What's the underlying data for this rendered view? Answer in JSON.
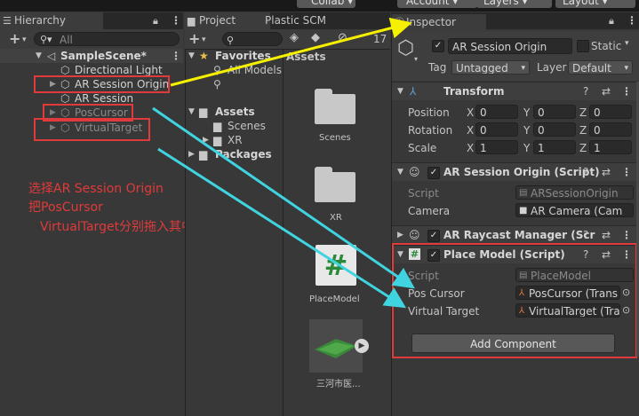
{
  "top_bar": {
    "collab": "Collab",
    "account": "Account",
    "layers": "Layers",
    "layout": "Layout"
  },
  "hierarchy": {
    "tab": "Hierarchy",
    "search_placeholder": "All",
    "scene": "SampleScene*",
    "items": [
      {
        "label": "Directional Light"
      },
      {
        "label": "AR Session Origin"
      },
      {
        "label": "AR Session"
      },
      {
        "label": "PosCursor"
      },
      {
        "label": "VirtualTarget"
      }
    ]
  },
  "project": {
    "tab_project": "Project",
    "tab_plastic": "Plastic SCM",
    "count": "17",
    "tree": {
      "favorites": "Favorites",
      "all_models": "All Models",
      "assets": "Assets",
      "scenes": "Scenes",
      "xr": "XR",
      "packages": "Packages"
    },
    "assets_header": "Assets",
    "grid": [
      {
        "label": "Scenes"
      },
      {
        "label": "XR"
      },
      {
        "label": "PlaceModel"
      },
      {
        "label": "三河市医..."
      }
    ]
  },
  "inspector": {
    "tab": "Inspector",
    "object_name": "AR Session Origin",
    "static_label": "Static",
    "tag_label": "Tag",
    "tag_value": "Untagged",
    "layer_label": "Layer",
    "layer_value": "Default",
    "transform": {
      "title": "Transform",
      "rows": [
        {
          "label": "Position",
          "x": "0",
          "y": "0",
          "z": "0"
        },
        {
          "label": "Rotation",
          "x": "0",
          "y": "0",
          "z": "0"
        },
        {
          "label": "Scale",
          "x": "1",
          "y": "1",
          "z": "1"
        }
      ],
      "axis_x": "X",
      "axis_y": "Y",
      "axis_z": "Z"
    },
    "ar_session_origin": {
      "title": "AR Session Origin (Script)",
      "script_label": "Script",
      "script_value": "ARSessionOrigin",
      "camera_label": "Camera",
      "camera_value": "AR Camera (Cam"
    },
    "ar_raycast": {
      "title": "AR Raycast Manager (Scr"
    },
    "place_model": {
      "title": "Place Model (Script)",
      "script_label": "Script",
      "script_value": "PlaceModel",
      "pos_label": "Pos Cursor",
      "pos_value": "PosCursor (Trans",
      "vt_label": "Virtual Target",
      "vt_value": "VirtualTarget (Tra"
    },
    "add_component": "Add Component"
  },
  "annotation": {
    "line1": "选择AR Session Origin",
    "line2": "把PosCursor",
    "line3": "VirtualTarget分别拖入其中"
  },
  "colors": {
    "accent_red": "#e03a3a",
    "arrow_yellow": "#f5f000",
    "arrow_cyan": "#3fd4e0",
    "selection": "#2c5d87"
  }
}
